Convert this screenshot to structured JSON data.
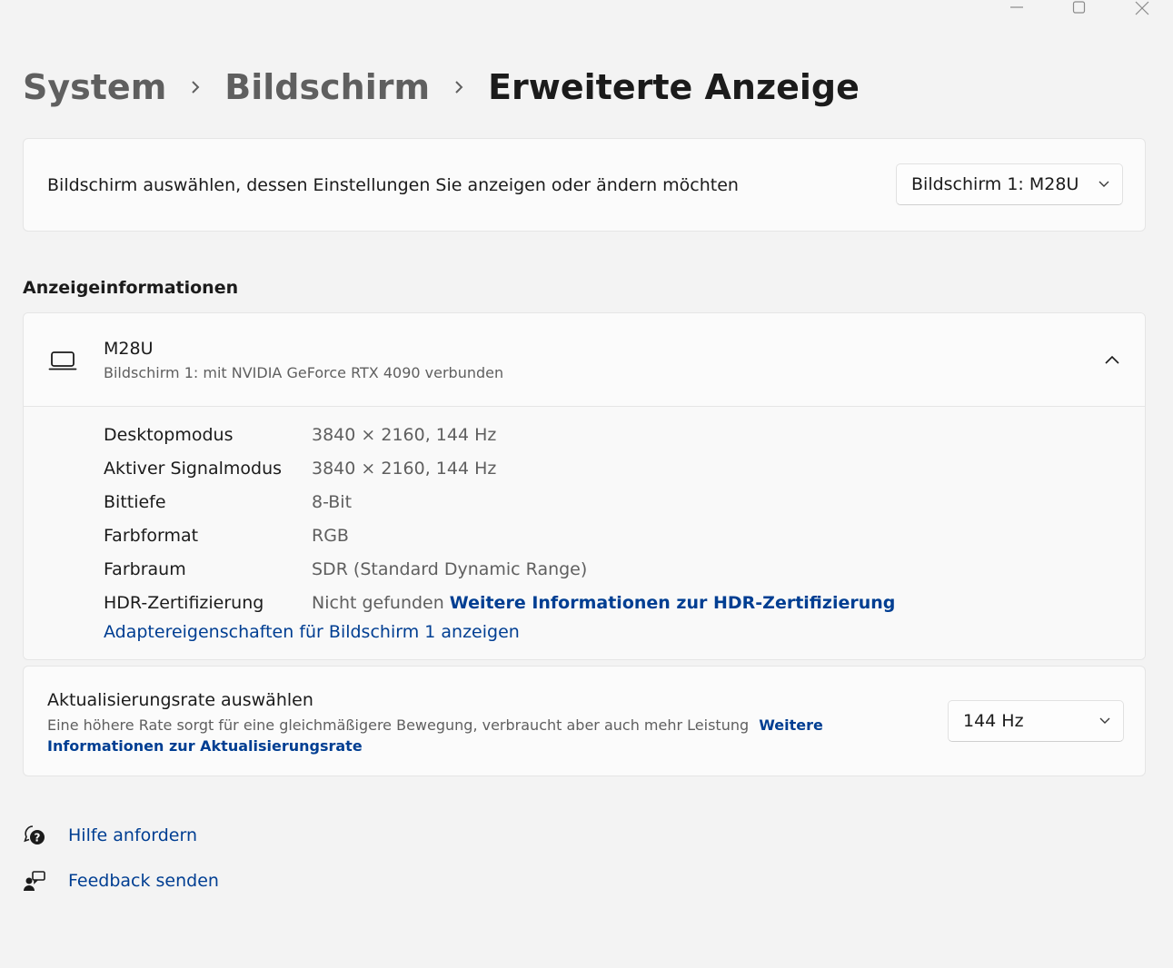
{
  "breadcrumb": {
    "items": [
      "System",
      "Bildschirm",
      "Erweiterte Anzeige"
    ]
  },
  "display_select": {
    "label": "Bildschirm auswählen, dessen Einstellungen Sie anzeigen oder ändern möchten",
    "selected": "Bildschirm 1: M28U"
  },
  "section": {
    "title": "Anzeigeinformationen"
  },
  "display_info": {
    "name": "M28U",
    "subtitle": "Bildschirm 1: mit NVIDIA GeForce RTX 4090 verbunden",
    "properties": [
      {
        "key": "Desktopmodus",
        "value": "3840 × 2160, 144 Hz"
      },
      {
        "key": "Aktiver Signalmodus",
        "value": "3840 × 2160, 144 Hz"
      },
      {
        "key": "Bittiefe",
        "value": "8-Bit"
      },
      {
        "key": "Farbformat",
        "value": "RGB"
      },
      {
        "key": "Farbraum",
        "value": "SDR (Standard Dynamic Range)"
      },
      {
        "key": "HDR-Zertifizierung",
        "value": "Nicht gefunden",
        "link": "Weitere Informationen zur HDR-Zertifizierung"
      }
    ],
    "adapter_link": "Adaptereigenschaften für Bildschirm 1 anzeigen"
  },
  "refresh_rate": {
    "title": "Aktualisierungsrate auswählen",
    "description": "Eine höhere Rate sorgt für eine gleichmäßigere Bewegung, verbraucht aber auch mehr Leistung",
    "link": "Weitere Informationen zur Aktualisierungsrate",
    "selected": "144 Hz"
  },
  "help": {
    "get_help": "Hilfe anfordern",
    "feedback": "Feedback senden"
  },
  "colors": {
    "background": "#f3f3f3",
    "card": "#fbfbfb",
    "link": "#003e92",
    "secondary_text": "#5f5f5f"
  }
}
